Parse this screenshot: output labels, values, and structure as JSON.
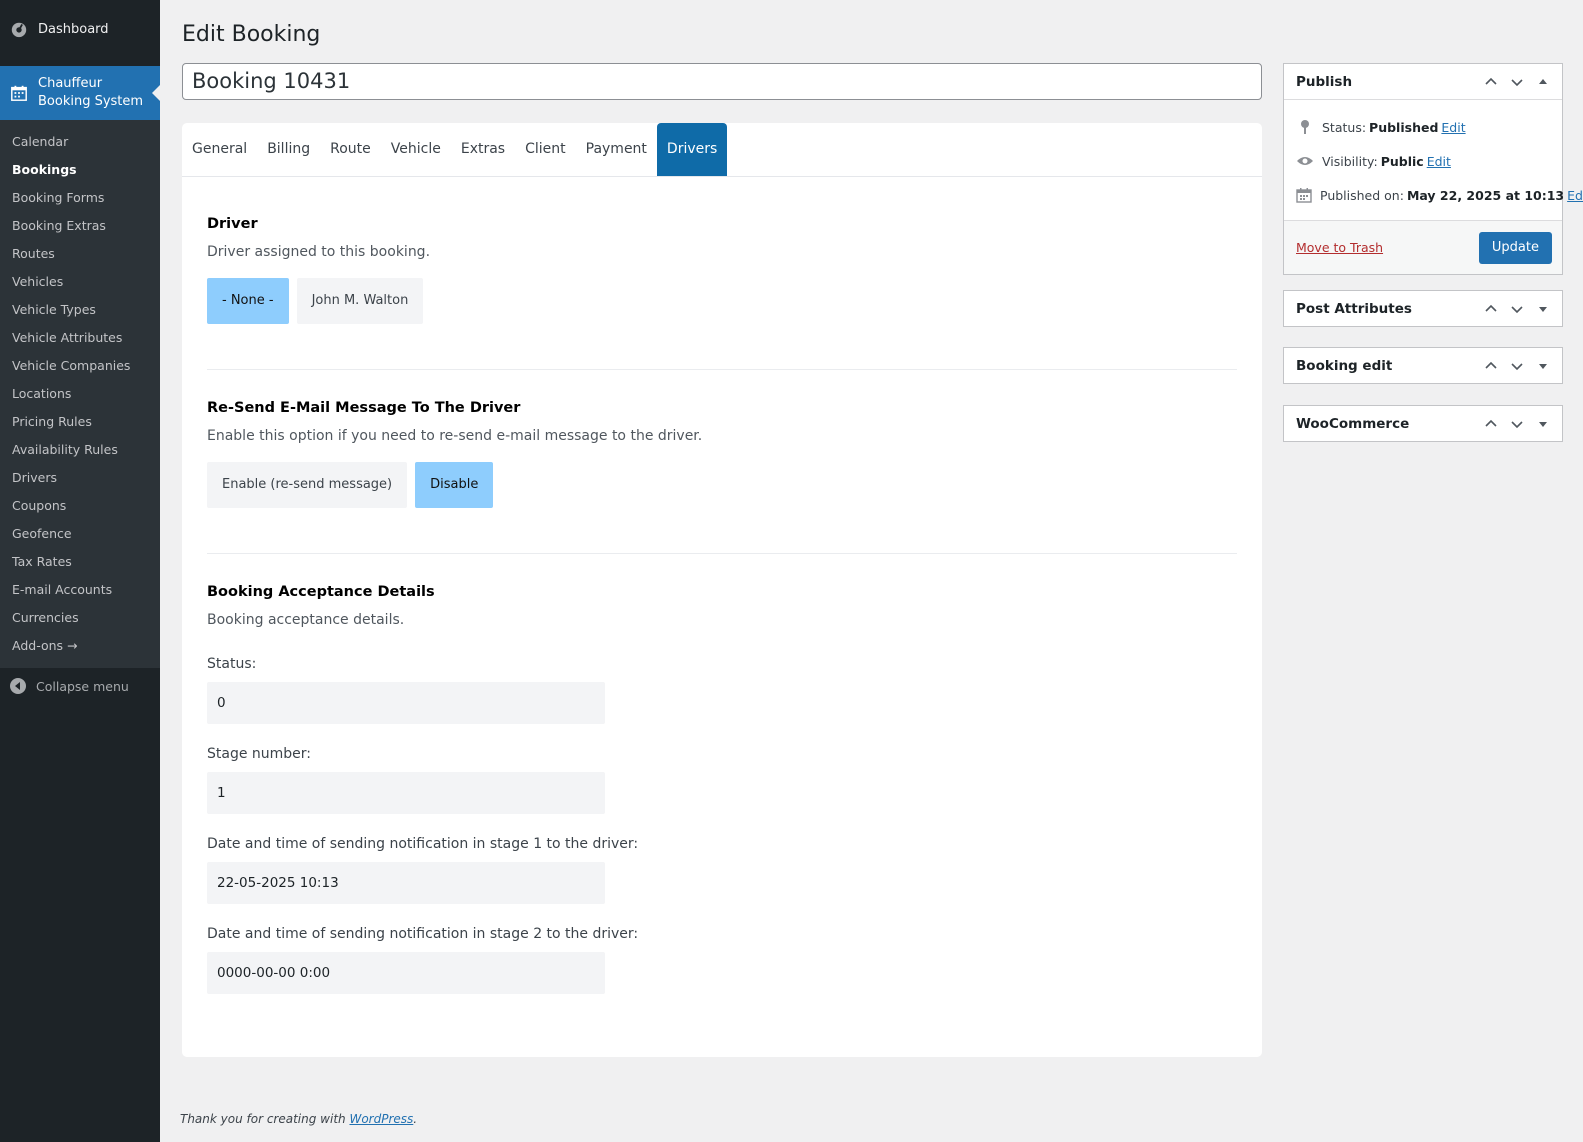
{
  "sidebar": {
    "dashboard_label": "Dashboard",
    "active_menu_label_line1": "Chauffeur",
    "active_menu_label_line2": "Booking System",
    "items": [
      {
        "label": "Calendar"
      },
      {
        "label": "Bookings"
      },
      {
        "label": "Booking Forms"
      },
      {
        "label": "Booking Extras"
      },
      {
        "label": "Routes"
      },
      {
        "label": "Vehicles"
      },
      {
        "label": "Vehicle Types"
      },
      {
        "label": "Vehicle Attributes"
      },
      {
        "label": "Vehicle Companies"
      },
      {
        "label": "Locations"
      },
      {
        "label": "Pricing Rules"
      },
      {
        "label": "Availability Rules"
      },
      {
        "label": "Drivers"
      },
      {
        "label": "Coupons"
      },
      {
        "label": "Geofence"
      },
      {
        "label": "Tax Rates"
      },
      {
        "label": "E-mail Accounts"
      },
      {
        "label": "Currencies"
      },
      {
        "label": "Add-ons →"
      }
    ],
    "current_item": "Bookings",
    "collapse_label": "Collapse menu"
  },
  "page": {
    "title": "Edit Booking",
    "post_title_value": "Booking 10431"
  },
  "tabs": [
    {
      "label": "General"
    },
    {
      "label": "Billing"
    },
    {
      "label": "Route"
    },
    {
      "label": "Vehicle"
    },
    {
      "label": "Extras"
    },
    {
      "label": "Client"
    },
    {
      "label": "Payment"
    },
    {
      "label": "Drivers"
    }
  ],
  "active_tab": "Drivers",
  "driver_section": {
    "title": "Driver",
    "description": "Driver assigned to this booking.",
    "options": [
      "- None -",
      "John M. Walton"
    ],
    "selected": "- None -"
  },
  "resend_section": {
    "title": "Re-Send E-Mail Message To The Driver",
    "description": "Enable this option if you need to re-send e-mail message to the driver.",
    "options": [
      "Enable (re-send message)",
      "Disable"
    ],
    "selected": "Disable"
  },
  "acceptance_section": {
    "title": "Booking Acceptance Details",
    "description": "Booking acceptance details.",
    "fields": [
      {
        "label": "Status:",
        "value": "0"
      },
      {
        "label": "Stage number:",
        "value": "1"
      },
      {
        "label": "Date and time of sending notification in stage 1 to the driver:",
        "value": "22-05-2025 10:13"
      },
      {
        "label": "Date and time of sending notification in stage 2 to the driver:",
        "value": "0000-00-00 0:00"
      }
    ]
  },
  "publish": {
    "title": "Publish",
    "status_label": "Status:",
    "status_value": "Published",
    "visibility_label": "Visibility:",
    "visibility_value": "Public",
    "published_label": "Published on:",
    "published_value": "May 22, 2025 at 10:13",
    "edit_link": "Edit",
    "trash_label": "Move to Trash",
    "update_label": "Update"
  },
  "boxes": [
    {
      "title": "Post Attributes"
    },
    {
      "title": "Booking edit"
    },
    {
      "title": "WooCommerce"
    }
  ],
  "footer": {
    "text": "Thank you for creating with ",
    "link": "WordPress",
    "suffix": "."
  },
  "colors": {
    "sidebar_bg": "#1d2327",
    "accent": "#2271b1",
    "tab_active": "#0f6ba8",
    "option_selected": "#8ecdfd"
  }
}
